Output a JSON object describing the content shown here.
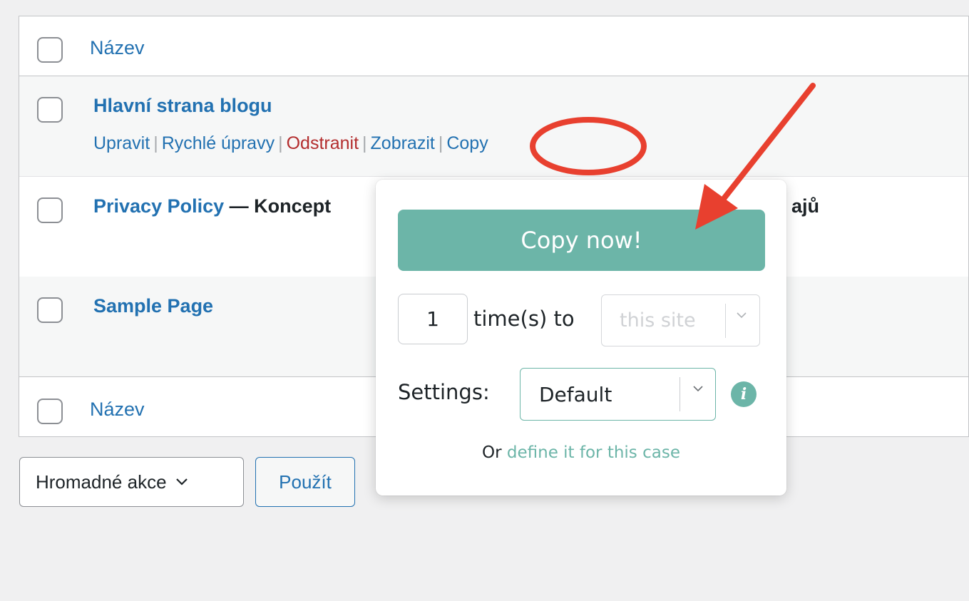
{
  "table": {
    "header_title": "Název",
    "footer_title": "Název",
    "rows": [
      {
        "title": "Hlavní strana blogu",
        "actions": {
          "edit": "Upravit",
          "quick_edit": "Rychlé úpravy",
          "delete": "Odstranit",
          "view": "Zobrazit",
          "copy": "Copy"
        }
      },
      {
        "title": "Privacy Policy",
        "state": " — Koncept",
        "tail_text": "ajů"
      },
      {
        "title": "Sample Page"
      }
    ]
  },
  "bulk": {
    "select_label": "Hromadné akce",
    "apply_label": "Použít"
  },
  "popover": {
    "copy_button": "Copy now!",
    "times_value": "1",
    "times_label": "time(s) to",
    "site_value": "this site",
    "settings_label": "Settings:",
    "settings_value": "Default",
    "info_icon": "i",
    "define_prefix": "Or ",
    "define_link": "define it for this case"
  },
  "icons": {
    "chevron": "chevron-down-icon",
    "info": "info-icon"
  },
  "colors": {
    "accent_green": "#6cb5a8",
    "wp_blue": "#2271b1",
    "danger_red": "#b32d2e",
    "annotation_red": "#e8402f"
  }
}
